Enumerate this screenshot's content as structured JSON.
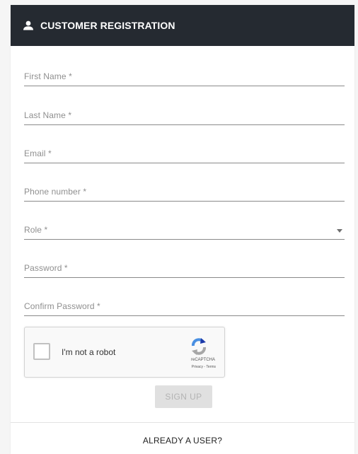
{
  "header": {
    "icon": "person-icon",
    "title": "CUSTOMER REGISTRATION"
  },
  "form": {
    "first_name": {
      "label": "First Name *",
      "value": ""
    },
    "last_name": {
      "label": "Last Name *",
      "value": ""
    },
    "email": {
      "label": "Email *",
      "value": ""
    },
    "phone": {
      "label": "Phone number *",
      "value": ""
    },
    "role": {
      "label": "Role *",
      "selected": ""
    },
    "password": {
      "label": "Password *",
      "value": ""
    },
    "confirm_password": {
      "label": "Confirm Password *",
      "value": ""
    }
  },
  "recaptcha": {
    "checkbox_label": "I'm not a robot",
    "brand": "reCAPTCHA",
    "links": "Privacy - Terms",
    "checked": false
  },
  "signup_button": {
    "label": "SIGN UP",
    "disabled": true
  },
  "footer": {
    "link": "ALREADY A USER?"
  },
  "colors": {
    "header_bg": "#252a31",
    "header_text": "#ffffff",
    "page_bg": "#f5f5f5",
    "button_disabled_bg": "#e0e0e0",
    "button_disabled_text": "#b3b3b3"
  }
}
